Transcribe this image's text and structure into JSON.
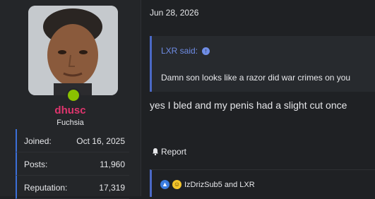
{
  "user": {
    "username": "dhusc",
    "title": "Fuchsia",
    "username_color": "#e0356e",
    "online_color": "#8ac100"
  },
  "stats": [
    {
      "label": "Joined:",
      "value": "Oct 16, 2025"
    },
    {
      "label": "Posts:",
      "value": "11,960"
    },
    {
      "label": "Reputation:",
      "value": "17,319"
    }
  ],
  "post": {
    "date": "Jun 28, 2026",
    "quote": {
      "author_line": "LXR said:",
      "body": "Damn son looks like a razor did war crimes on you",
      "icon": "arrow-up-circle-icon"
    },
    "text": "yes I bled and my penis had a slight cut once",
    "report_label": "Report",
    "report_icon": "bell-icon",
    "reactions_text": "IzDrizSub5 and LXR",
    "reaction_icons": [
      "like-icon",
      "laugh-icon"
    ]
  },
  "colors": {
    "background": "#1f2124",
    "accent_blue": "#4b69c6",
    "quote_link": "#6f8de6"
  }
}
